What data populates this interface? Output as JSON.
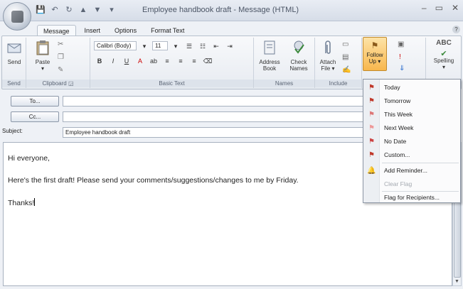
{
  "window": {
    "title": "Employee handbook draft - Message (HTML)",
    "controls": [
      "–",
      "▭",
      "✕"
    ]
  },
  "quick_access": [
    "💾",
    "↶",
    "↻",
    "▲",
    "▼",
    "▾"
  ],
  "tabs": [
    {
      "label": "Message",
      "active": true
    },
    {
      "label": "Insert",
      "active": false
    },
    {
      "label": "Options",
      "active": false
    },
    {
      "label": "Format Text",
      "active": false
    }
  ],
  "ribbon": {
    "send": {
      "label": "Send",
      "group": "Send"
    },
    "clipboard": {
      "paste_label": "Paste",
      "group": "Clipboard"
    },
    "basic_text": {
      "font": "Calibri (Body)",
      "size": "11",
      "group": "Basic Text"
    },
    "names": {
      "address_book": [
        "Address",
        "Book"
      ],
      "check_names": [
        "Check",
        "Names"
      ],
      "group": "Names"
    },
    "include": {
      "attach_file": [
        "Attach",
        "File"
      ],
      "group": "Include"
    },
    "follow_up": {
      "label": [
        "Follow",
        "Up"
      ]
    },
    "proofing": {
      "spelling_label": "Spelling",
      "abc": "ABC"
    }
  },
  "header": {
    "to_label": "To...",
    "cc_label": "Cc...",
    "subject_label": "Subject:",
    "subject_value": "Employee handbook draft"
  },
  "body": {
    "lines": [
      "Hi everyone,",
      "Here's the first draft! Please send your comments/suggestions/changes to me by Friday.",
      "Thanks!"
    ]
  },
  "menu": {
    "items": [
      {
        "label": "Today",
        "icon": "flag-icon",
        "disabled": false
      },
      {
        "label": "Tomorrow",
        "icon": "flag-icon",
        "disabled": false
      },
      {
        "label": "This Week",
        "icon": "flag-icon",
        "disabled": false
      },
      {
        "label": "Next Week",
        "icon": "flag-icon",
        "disabled": false
      },
      {
        "label": "No Date",
        "icon": "flag-icon",
        "disabled": false
      },
      {
        "label": "Custom...",
        "icon": "flag-icon",
        "disabled": false
      },
      {
        "label": "Add Reminder...",
        "icon": "bell-icon",
        "disabled": false
      },
      {
        "label": "Clear Flag",
        "icon": "",
        "disabled": true
      },
      {
        "label": "Flag for Recipients...",
        "icon": "",
        "disabled": false
      }
    ]
  }
}
